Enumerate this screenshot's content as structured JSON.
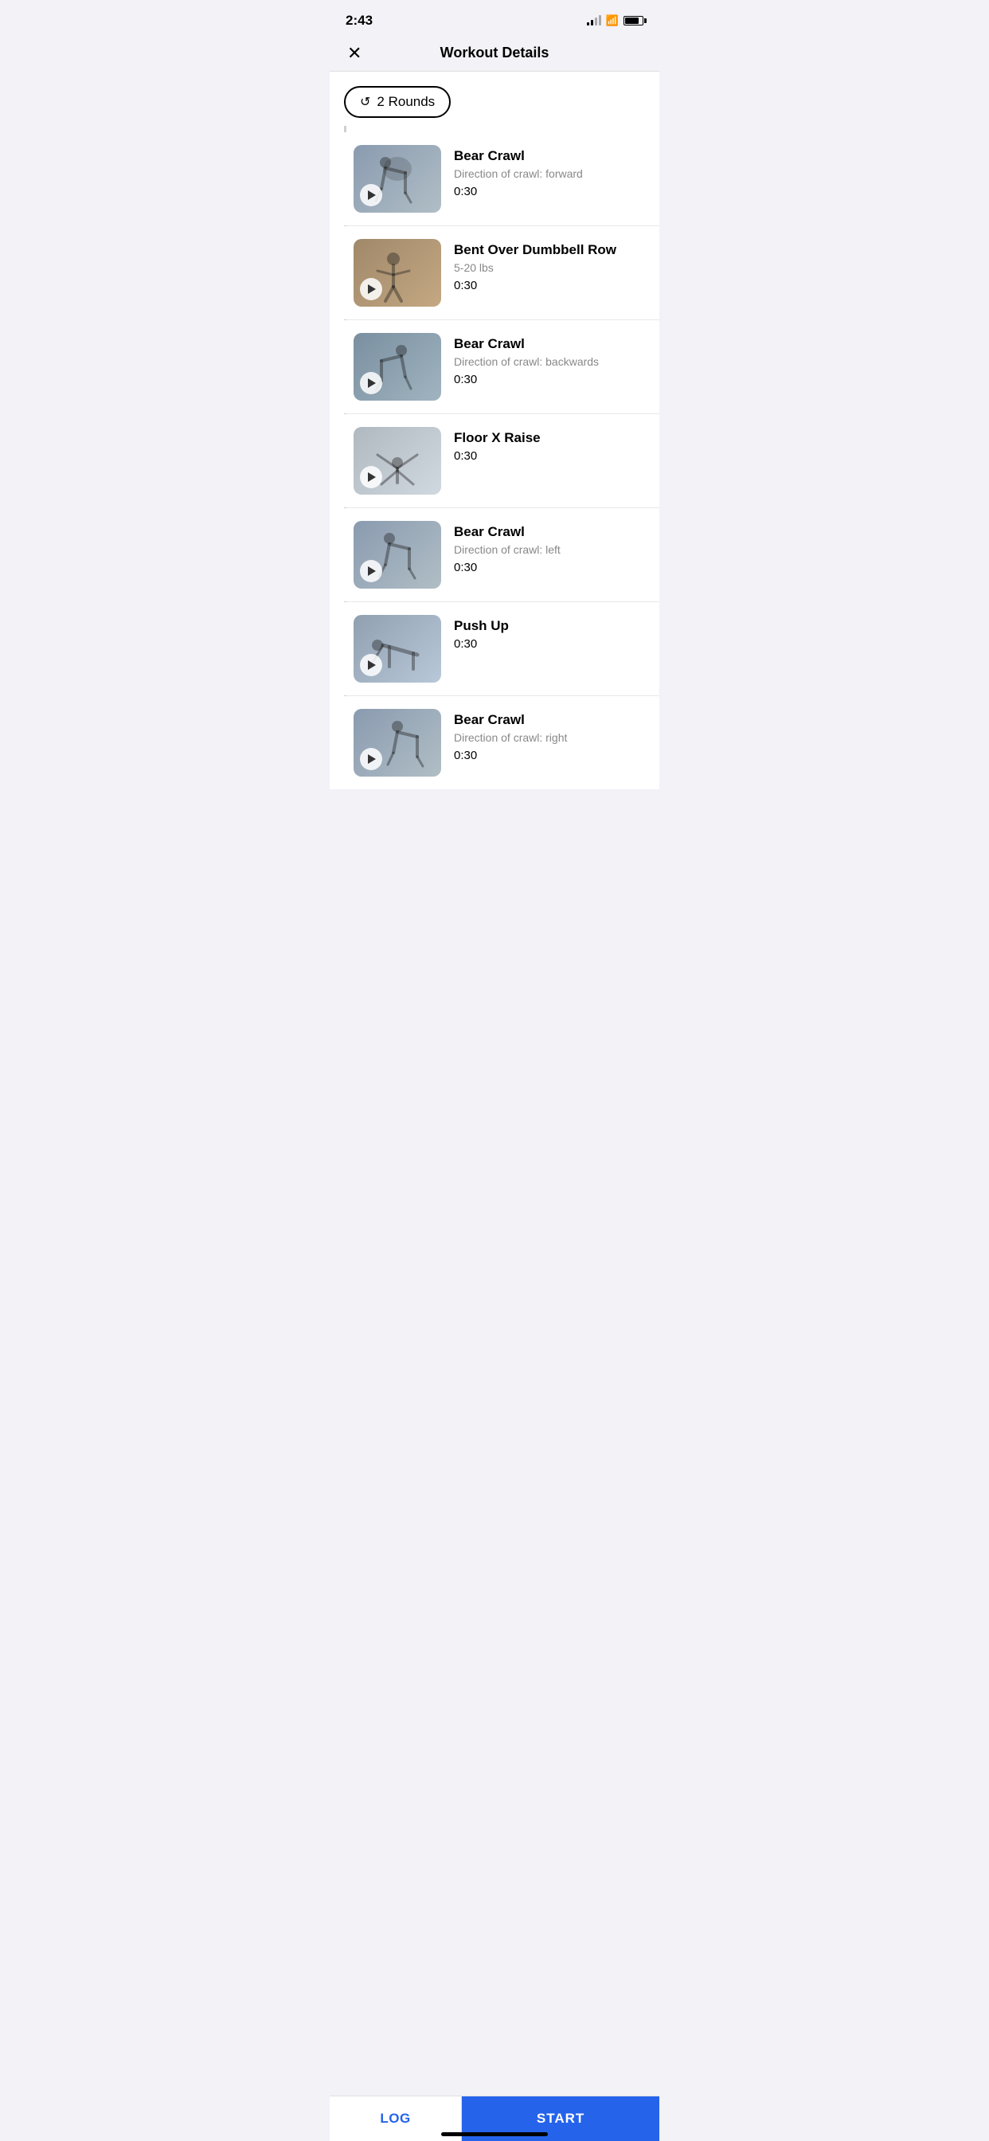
{
  "status": {
    "time": "2:43",
    "signal_bars": [
      4,
      7,
      10,
      13
    ],
    "battery_percent": 80
  },
  "header": {
    "close_label": "✕",
    "title": "Workout Details"
  },
  "rounds": {
    "icon": "↻",
    "label": "2 Rounds"
  },
  "exercises": [
    {
      "id": 1,
      "name": "Bear Crawl",
      "detail": "Direction of crawl: forward",
      "duration": "0:30",
      "thumb_class": "thumb-1"
    },
    {
      "id": 2,
      "name": "Bent Over Dumbbell Row",
      "detail": "5-20 lbs",
      "duration": "0:30",
      "thumb_class": "thumb-2"
    },
    {
      "id": 3,
      "name": "Bear Crawl",
      "detail": "Direction of crawl: backwards",
      "duration": "0:30",
      "thumb_class": "thumb-3"
    },
    {
      "id": 4,
      "name": "Floor X Raise",
      "detail": "",
      "duration": "0:30",
      "thumb_class": "thumb-4"
    },
    {
      "id": 5,
      "name": "Bear Crawl",
      "detail": "Direction of crawl: left",
      "duration": "0:30",
      "thumb_class": "thumb-5"
    },
    {
      "id": 6,
      "name": "Push Up",
      "detail": "",
      "duration": "0:30",
      "thumb_class": "thumb-6"
    },
    {
      "id": 7,
      "name": "Bear Crawl",
      "detail": "Direction of crawl: right",
      "duration": "0:30",
      "thumb_class": "thumb-7"
    }
  ],
  "buttons": {
    "log_label": "LOG",
    "start_label": "START"
  }
}
